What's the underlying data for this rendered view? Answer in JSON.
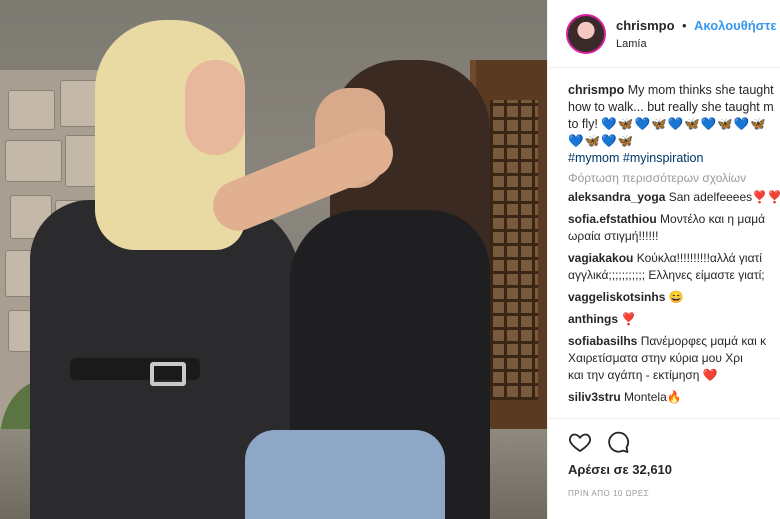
{
  "header": {
    "username": "chrismpo",
    "separator": "•",
    "follow_label": "Ακολουθήστε",
    "location": "Lamía",
    "avatar_icon": "profile-avatar"
  },
  "caption": {
    "username": "chrismpo",
    "text_line1": "My mom thinks she taught",
    "text_line2": "how to walk... but really she taught m",
    "text_line3": "to fly!",
    "emoji_row1": "💙🦋💙🦋💙🦋💙🦋💙🦋",
    "emoji_row2": "💙🦋💙🦋",
    "hashtags": "#mymom #myinspiration"
  },
  "load_more": "Φόρτωση περισσότερων σχολίων",
  "comments": [
    {
      "user": "aleksandra_yoga",
      "text": "San adelfeeees❣️❣️",
      "text2": ""
    },
    {
      "user": "sofia.efstathiou",
      "text": "Μοντέλο και η μαμά",
      "text2": "ωραία στιγμή!!!!!!"
    },
    {
      "user": "vagiakakou",
      "text": "Κούκλα!!!!!!!!!!αλλά γιατί",
      "text2": "αγγλικά;;;;;;;;;;; Ελληνες είμαστε γιατί;"
    },
    {
      "user": "vaggeliskotsinhs",
      "text": "😄",
      "text2": ""
    },
    {
      "user": "anthings",
      "text": "❣️",
      "text2": ""
    },
    {
      "user": "sofiabasilhs",
      "text": "Πανέμορφες μαμά και κ",
      "text2": "Χαιρετίσματα στην κύρια μου Χρι"
    },
    {
      "user": "",
      "text": "",
      "text2": "και την αγάπη - εκτίμηση ❤️"
    },
    {
      "user": "siliv3stru",
      "text": "Montela🔥",
      "text2": ""
    }
  ],
  "actions": {
    "like_icon": "heart-icon",
    "comment_icon": "comment-icon"
  },
  "likes": "Αρέσει σε 32,610",
  "timestamp": "ΠΡΙΝ ΑΠΟ 10 ΩΡΕΣ",
  "colors": {
    "follow": "#3897f0",
    "hashtag": "#003569",
    "muted": "#999999"
  }
}
